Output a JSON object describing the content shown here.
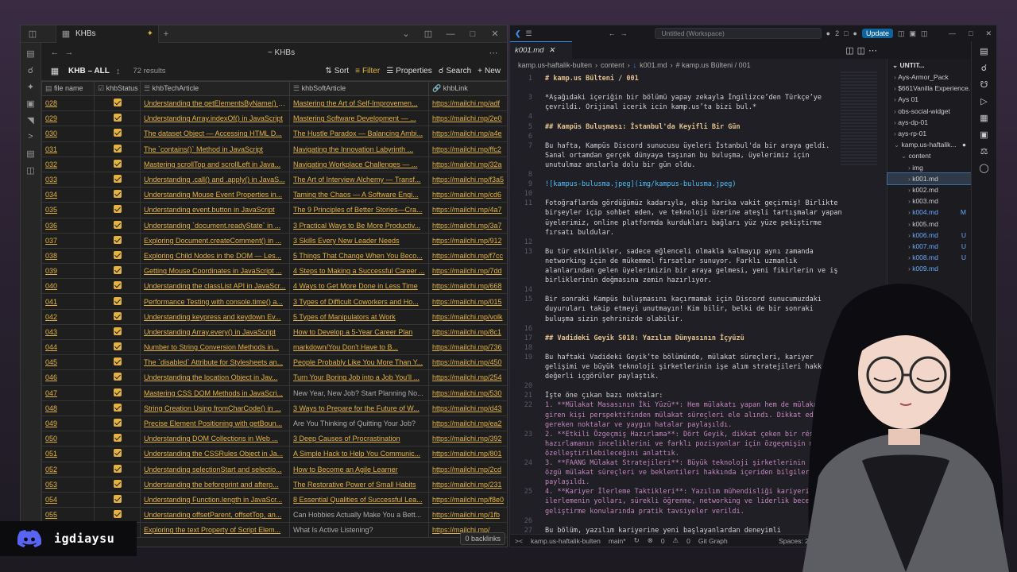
{
  "obsidian": {
    "tab_title": "KHBs",
    "page_title": "~ KHBs",
    "view_name": "KHB – ALL",
    "results_count": "72 results",
    "toolbar": {
      "sort": "Sort",
      "filter": "Filter",
      "properties": "Properties",
      "search": "Search",
      "new": "New"
    },
    "columns": [
      "file name",
      "khbStatus",
      "khbTechArticle",
      "khbSoftArticle",
      "khbLink"
    ],
    "rows": [
      {
        "name": "028",
        "tech": "Understanding the getElementsByName() Met...",
        "soft": "Mastering the Art of Self-Improvemen...",
        "link": "https://mailchi.mp/adf"
      },
      {
        "name": "029",
        "tech": "Understanding Array.indexOf() in JavaScript",
        "soft": "Mastering Software Development — ...",
        "link": "https://mailchi.mp/2e0"
      },
      {
        "name": "030",
        "tech": "The dataset Object — Accessing HTML D...",
        "soft": "The Hustle Paradox — Balancing Ambi...",
        "link": "https://mailchi.mp/a4e"
      },
      {
        "name": "031",
        "tech": "The `contains()` Method in JavaScript",
        "soft": "Navigating the Innovation Labyrinth ...",
        "link": "https://mailchi.mp/ffc2"
      },
      {
        "name": "032",
        "tech": "Mastering scrollTop and scrollLeft in Java...",
        "soft": "Navigating Workplace Challenges — ...",
        "link": "https://mailchi.mp/32a"
      },
      {
        "name": "033",
        "tech": "Understanding .call() and .apply() in JavaS...",
        "soft": "The Art of Interview Alchemy — Transf...",
        "link": "https://mailchi.mp/f3a5"
      },
      {
        "name": "034",
        "tech": "Understanding Mouse Event Properties in...",
        "soft": "Taming the Chaos — A Software Engi...",
        "link": "https://mailchi.mp/cd6"
      },
      {
        "name": "035",
        "tech": "Understanding event.button in JavaScript",
        "soft": "The 9 Principles of Better Stories—Cra...",
        "link": "https://mailchi.mp/4a7"
      },
      {
        "name": "036",
        "tech": "Understanding `document.readyState` in ...",
        "soft": "3 Practical Ways to Be More Productiv...",
        "link": "https://mailchi.mp/3a7"
      },
      {
        "name": "037",
        "tech": "Exploring Document.createComment() in ...",
        "soft": "3 Skills Every New Leader Needs",
        "link": "https://mailchi.mp/912"
      },
      {
        "name": "038",
        "tech": "Exploring Child Nodes in the DOM — Les...",
        "soft": "5 Things That Change When You Beco...",
        "link": "https://mailchi.mp/f7cc"
      },
      {
        "name": "039",
        "tech": "Getting Mouse Coordinates in JavaScript ...",
        "soft": "4 Steps to Making a Successful Career ...",
        "link": "https://mailchi.mp/7dd"
      },
      {
        "name": "040",
        "tech": "Understanding the classList API in JavaScr...",
        "soft": "4 Ways to Get More Done in Less Time",
        "link": "https://mailchi.mp/668"
      },
      {
        "name": "041",
        "tech": "Performance Testing with console.time() a...",
        "soft": "3 Types of Difficult Coworkers and Ho...",
        "link": "https://mailchi.mp/015"
      },
      {
        "name": "042",
        "tech": "Understanding keypress and keydown Ev...",
        "soft": "5 Types of Manipulators at Work",
        "link": "https://mailchi.mp/volk"
      },
      {
        "name": "043",
        "tech": "Understanding Array.every() in JavaScript",
        "soft": "How to Develop a 5-Year Career Plan",
        "link": "https://mailchi.mp/8c1"
      },
      {
        "name": "044",
        "tech": "Number to String Conversion Methods in...",
        "soft": "markdown/You Don't Have to B...",
        "link": "https://mailchi.mp/736"
      },
      {
        "name": "045",
        "tech": "The `disabled` Attribute for Stylesheets an...",
        "soft": "People Probably Like You More Than Y...",
        "link": "https://mailchi.mp/450"
      },
      {
        "name": "046",
        "tech": "Understanding the location Object in Jav...",
        "soft": "Turn Your Boring Job into a Job You'll ...",
        "link": "https://mailchi.mp/254"
      },
      {
        "name": "047",
        "tech": "Mastering CSS DOM Methods in JavaScri...",
        "soft": "New Year, New Job? Start Planning No...",
        "link": "https://mailchi.mp/530",
        "dim": true
      },
      {
        "name": "048",
        "tech": "String Creation Using fromCharCode() in ...",
        "soft": "3 Ways to Prepare for the Future of W...",
        "link": "https://mailchi.mp/d43"
      },
      {
        "name": "049",
        "tech": "Precise Element Positioning with getBoun...",
        "soft": "Are You Thinking of Quitting Your Job?",
        "link": "https://mailchi.mp/ea2",
        "dim": true
      },
      {
        "name": "050",
        "tech": "Understanding DOM Collections in Web ...",
        "soft": "3 Deep Causes of Procrastination",
        "link": "https://mailchi.mp/392"
      },
      {
        "name": "051",
        "tech": "Understanding the CSSRules Object in Ja...",
        "soft": "A Simple Hack to Help You Communic...",
        "link": "https://mailchi.mp/801"
      },
      {
        "name": "052",
        "tech": "Understanding selectionStart and selectio...",
        "soft": "How to Become an Agile Learner",
        "link": "https://mailchi.mp/2cd"
      },
      {
        "name": "053",
        "tech": "Understanding the beforeprint and afterp...",
        "soft": "The Restorative Power of Small Habits",
        "link": "https://mailchi.mp/231"
      },
      {
        "name": "054",
        "tech": "Understanding Function.length in JavaScr...",
        "soft": "8 Essential Qualities of Successful Lea...",
        "link": "https://mailchi.mp/f8e0"
      },
      {
        "name": "055",
        "tech": "Understanding offsetParent, offsetTop, an...",
        "soft": "Can Hobbies Actually Make You a Bett...",
        "link": "https://mailchi.mp/1fb",
        "dim": true
      },
      {
        "name": "056",
        "tech": "Exploring the text Property of Script Elem...",
        "soft": "What Is Active Listening?",
        "link": "https://mailchi.mp/",
        "dim": true
      }
    ],
    "backlinks": "0 backlinks"
  },
  "vscode": {
    "search_text": "Untitled (Workspace)",
    "notif_count": "2",
    "update_label": "Update",
    "tab_label": "k001.md",
    "breadcrumb": [
      "kamp.us-haftalik-bulten",
      "content",
      "k001.md",
      "# kamp.us Bülteni / 001"
    ],
    "lines": [
      {
        "n": "1",
        "t": "# kamp.us Bülteni / 001",
        "c": "h2"
      },
      {
        "n": "",
        "t": "",
        "c": ""
      },
      {
        "n": "3",
        "t": "*Aşağıdaki içeriğin bir bölümü yapay zekayla İngilizce’den Türkçe’ye",
        "c": ""
      },
      {
        "n": "",
        "t": "çevrildi. Orijinal icerik icin kamp.us’ta bizi bul.*",
        "c": ""
      },
      {
        "n": "4",
        "t": "",
        "c": ""
      },
      {
        "n": "5",
        "t": "## Kampüs Buluşması: İstanbul'da Keyifli Bir Gün",
        "c": "h2"
      },
      {
        "n": "6",
        "t": "",
        "c": ""
      },
      {
        "n": "7",
        "t": "Bu hafta, Kampüs Discord sunucusu üyeleri İstanbul'da bir araya geldi.",
        "c": ""
      },
      {
        "n": "",
        "t": "Sanal ortamdan gerçek dünyaya taşınan bu buluşma, üyelerimiz için",
        "c": ""
      },
      {
        "n": "",
        "t": "unutulmaz anılarla dolu bir gün oldu.",
        "c": ""
      },
      {
        "n": "8",
        "t": "",
        "c": ""
      },
      {
        "n": "9",
        "t": "![kampus-bulusma.jpeg](img/kampus-bulusma.jpeg)",
        "c": "lk"
      },
      {
        "n": "10",
        "t": "",
        "c": ""
      },
      {
        "n": "11",
        "t": "Fotoğraflarda gördüğümüz kadarıyla, ekip harika vakit geçirmiş! Birlikte",
        "c": ""
      },
      {
        "n": "",
        "t": "birşeyler içip sohbet eden, ve teknoloji üzerine ateşli tartışmalar yapan",
        "c": ""
      },
      {
        "n": "",
        "t": "üyelerimiz, online platformda kurdukları bağları yüz yüze pekiştirme",
        "c": ""
      },
      {
        "n": "",
        "t": "fırsatı buldular.",
        "c": ""
      },
      {
        "n": "12",
        "t": "",
        "c": ""
      },
      {
        "n": "13",
        "t": "Bu tür etkinlikler, sadece eğlenceli olmakla kalmayıp aynı zamanda",
        "c": ""
      },
      {
        "n": "",
        "t": "networking için de mükemmel fırsatlar sunuyor. Farklı uzmanlık",
        "c": ""
      },
      {
        "n": "",
        "t": "alanlarından gelen üyelerimizin bir araya gelmesi, yeni fikirlerin ve iş",
        "c": ""
      },
      {
        "n": "",
        "t": "birliklerinin doğmasına zemin hazırlıyor.",
        "c": ""
      },
      {
        "n": "14",
        "t": "",
        "c": ""
      },
      {
        "n": "15",
        "t": "Bir sonraki Kampüs buluşmasını kaçırmamak için Discord sunucumuzdaki",
        "c": ""
      },
      {
        "n": "",
        "t": "duyuruları takip etmeyi unutmayın! Kim bilir, belki de bir sonraki",
        "c": ""
      },
      {
        "n": "",
        "t": "buluşma sizin şehrinizde olabilir.",
        "c": ""
      },
      {
        "n": "16",
        "t": "",
        "c": ""
      },
      {
        "n": "17",
        "t": "## Vadideki Geyik S018: Yazılım Dünyasının İçyüzü",
        "c": "h2"
      },
      {
        "n": "18",
        "t": "",
        "c": ""
      },
      {
        "n": "19",
        "t": "Bu haftaki Vadideki Geyik’te bölümünde, mülakat süreçleri, kariyer",
        "c": ""
      },
      {
        "n": "",
        "t": "gelişimi ve büyük teknoloji şirketlerinin işe alım stratejileri hakkında",
        "c": ""
      },
      {
        "n": "",
        "t": "değerli içgörüler paylaştık.",
        "c": ""
      },
      {
        "n": "20",
        "t": "",
        "c": ""
      },
      {
        "n": "21",
        "t": "İşte öne çıkan bazı noktalar:",
        "c": ""
      },
      {
        "n": "22",
        "t": "1. **Mülakat Masasının İki Yüzü**: Hem mülakatı yapan hem de mülakata",
        "c": "em"
      },
      {
        "n": "",
        "t": "giren kişi perspektifinden mülakat süreçleri ele alındı. Dikkat edilmesi",
        "c": "em"
      },
      {
        "n": "",
        "t": "gereken noktalar ve yaygın hatalar paylaşıldı.",
        "c": "em"
      },
      {
        "n": "23",
        "t": "2. **Etkili Özgeçmiş Hazırlama**: Dört Geyik, dikkat çeken bir résumé",
        "c": "em"
      },
      {
        "n": "",
        "t": "hazırlamanın inceliklerini ve farklı pozisyonlar için özgeçmişin nasıl",
        "c": "em"
      },
      {
        "n": "",
        "t": "özelleştirilebileceğini anlattık.",
        "c": "em"
      },
      {
        "n": "24",
        "t": "3. **FAANG Mülakat Stratejileri**: Büyük teknoloji şirketlerinin kendine",
        "c": "em"
      },
      {
        "n": "",
        "t": "özgü mülakat süreçleri ve beklentileri hakkında içeriden bilgiler",
        "c": "em"
      },
      {
        "n": "",
        "t": "paylaşıldı.",
        "c": "em"
      },
      {
        "n": "25",
        "t": "4. **Kariyer İlerleme Taktikleri**: Yazılım mühendisliği kariyerinde",
        "c": "em"
      },
      {
        "n": "",
        "t": "ilerlemenin yolları, sürekli öğrenme, networking ve liderlik becerileri",
        "c": "em"
      },
      {
        "n": "",
        "t": "geliştirme konularında pratik tavsiyeler verildi.",
        "c": "em"
      },
      {
        "n": "26",
        "t": "",
        "c": ""
      },
      {
        "n": "27",
        "t": "Bu bölüm, yazılım kariyerine yeni başlayanlardan deneyimli",
        "c": ""
      }
    ],
    "explorer": {
      "title": "UNTIT...",
      "items": [
        {
          "label": "Ays-Armor_Pack",
          "indent": 0,
          "st": ""
        },
        {
          "label": "$661Vanilla Experience...",
          "indent": 0,
          "st": ""
        },
        {
          "label": "Ays 01",
          "indent": 0,
          "st": ""
        },
        {
          "label": "obs-social-widget",
          "indent": 0,
          "st": ""
        },
        {
          "label": "ays-dp-01",
          "indent": 0,
          "st": ""
        },
        {
          "label": "ays-rp-01",
          "indent": 0,
          "st": ""
        },
        {
          "label": "kamp.us-haftalik...",
          "indent": 0,
          "st": "●",
          "open": true
        },
        {
          "label": "content",
          "indent": 1,
          "st": "",
          "open": true
        },
        {
          "label": "img",
          "indent": 2,
          "st": ""
        },
        {
          "label": "k001.md",
          "indent": 2,
          "st": "",
          "sel": true
        },
        {
          "label": "k002.md",
          "indent": 2,
          "st": ""
        },
        {
          "label": "k003.md",
          "indent": 2,
          "st": ""
        },
        {
          "label": "k004.md",
          "indent": 2,
          "st": "M",
          "mod": true
        },
        {
          "label": "k005.md",
          "indent": 2,
          "st": ""
        },
        {
          "label": "k006.md",
          "indent": 2,
          "st": "U",
          "mod": true
        },
        {
          "label": "k007.md",
          "indent": 2,
          "st": "U",
          "mod": true
        },
        {
          "label": "k008.md",
          "indent": 2,
          "st": "U",
          "mod": true
        },
        {
          "label": "k009.md",
          "indent": 2,
          "st": "",
          "mod": true
        }
      ]
    },
    "status": {
      "branch": "kamp.us-haftalik-bulten",
      "git": "main*",
      "errors": "0",
      "warnings": "0",
      "graph": "Git Graph",
      "spaces": "Spaces: 2",
      "enc": "U"
    }
  },
  "discord": {
    "name": "igdiaysu"
  }
}
